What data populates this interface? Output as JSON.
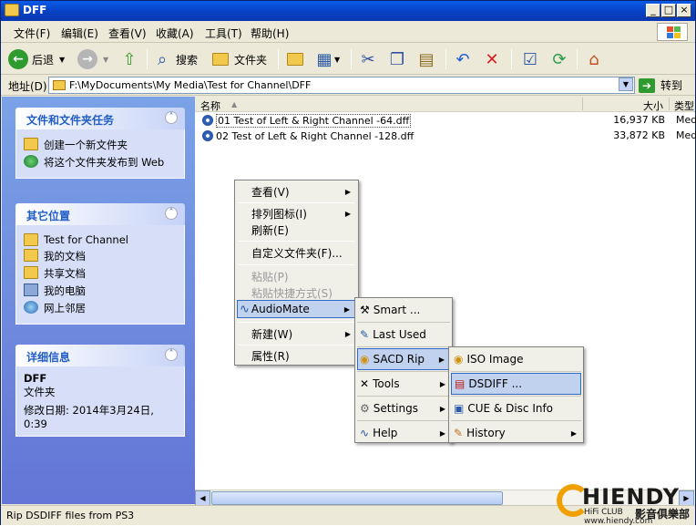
{
  "window": {
    "title": "DFF",
    "controls": [
      "_",
      "□",
      "×"
    ]
  },
  "menubar": {
    "items": [
      "文件(F)",
      "编辑(E)",
      "查看(V)",
      "收藏(A)",
      "工具(T)",
      "帮助(H)"
    ]
  },
  "toolbar": {
    "back_label": "后退",
    "search_label": "搜索",
    "folders_label": "文件夹"
  },
  "address": {
    "label": "地址(D)",
    "path": "F:\\MyDocuments\\My Media\\Test for Channel\\DFF",
    "go_label": "转到"
  },
  "sidebar": {
    "tasks": {
      "title": "文件和文件夹任务",
      "items": [
        "创建一个新文件夹",
        "将这个文件夹发布到 Web"
      ]
    },
    "places": {
      "title": "其它位置",
      "items": [
        "Test for Channel",
        "我的文档",
        "共享文档",
        "我的电脑",
        "网上邻居"
      ]
    },
    "details": {
      "title": "详细信息",
      "name": "DFF",
      "type": "文件夹",
      "modified": "修改日期: 2014年3月24日, 0:39"
    }
  },
  "filelist": {
    "columns": {
      "name": "名称",
      "size": "大小",
      "type": "类型"
    },
    "rows": [
      {
        "name": "01 Test of Left & Right Channel -64.dff",
        "size": "16,937 KB",
        "type": "Med"
      },
      {
        "name": "02 Test of Left & Right Channel -128.dff",
        "size": "33,872 KB",
        "type": "Med"
      }
    ]
  },
  "context_menu": {
    "items": [
      "查看(V)",
      "排列图标(I)",
      "刷新(E)",
      "自定义文件夹(F)...",
      "粘贴(P)",
      "粘贴快捷方式(S)",
      "AudioMate",
      "新建(W)",
      "属性(R)"
    ]
  },
  "audiomate_menu": {
    "items": [
      "Smart ...",
      "Last Used",
      "SACD Rip",
      "Tools",
      "Settings",
      "Help"
    ]
  },
  "sacd_menu": {
    "items": [
      "ISO Image",
      "DSDIFF ...",
      "CUE & Disc Info",
      "History"
    ]
  },
  "status": {
    "text": "Rip DSDIFF files from PS3"
  },
  "watermark": {
    "brand": "HIENDY",
    "sub": "HiFi CLUB  www.hiendy.com",
    "cn": "影音俱樂部"
  }
}
